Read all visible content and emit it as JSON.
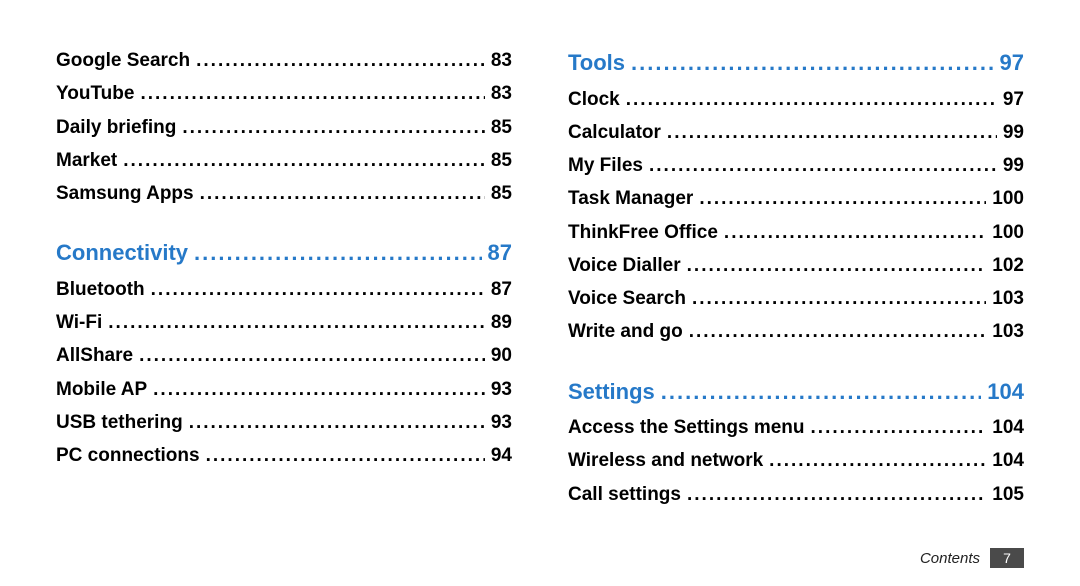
{
  "footer": {
    "label": "Contents",
    "page": "7"
  },
  "left": {
    "leading_items": [
      {
        "label": "Google Search",
        "page": "83"
      },
      {
        "label": "YouTube",
        "page": "83"
      },
      {
        "label": "Daily briefing",
        "page": "85"
      },
      {
        "label": "Market",
        "page": "85"
      },
      {
        "label": "Samsung Apps",
        "page": "85"
      }
    ],
    "section": {
      "label": "Connectivity",
      "page": "87"
    },
    "items": [
      {
        "label": "Bluetooth",
        "page": "87"
      },
      {
        "label": "Wi-Fi",
        "page": "89"
      },
      {
        "label": "AllShare",
        "page": "90"
      },
      {
        "label": "Mobile AP",
        "page": "93"
      },
      {
        "label": "USB tethering",
        "page": "93"
      },
      {
        "label": "PC connections",
        "page": "94"
      }
    ]
  },
  "right": {
    "section1": {
      "label": "Tools",
      "page": "97"
    },
    "items1": [
      {
        "label": "Clock",
        "page": "97"
      },
      {
        "label": "Calculator",
        "page": "99"
      },
      {
        "label": "My Files",
        "page": "99"
      },
      {
        "label": "Task Manager",
        "page": "100"
      },
      {
        "label": "ThinkFree Office",
        "page": "100"
      },
      {
        "label": "Voice Dialler",
        "page": "102"
      },
      {
        "label": "Voice Search",
        "page": "103"
      },
      {
        "label": "Write and go",
        "page": "103"
      }
    ],
    "section2": {
      "label": "Settings",
      "page": "104"
    },
    "items2": [
      {
        "label": "Access the Settings menu",
        "page": "104"
      },
      {
        "label": "Wireless and network",
        "page": "104"
      },
      {
        "label": "Call settings",
        "page": "105"
      }
    ]
  }
}
